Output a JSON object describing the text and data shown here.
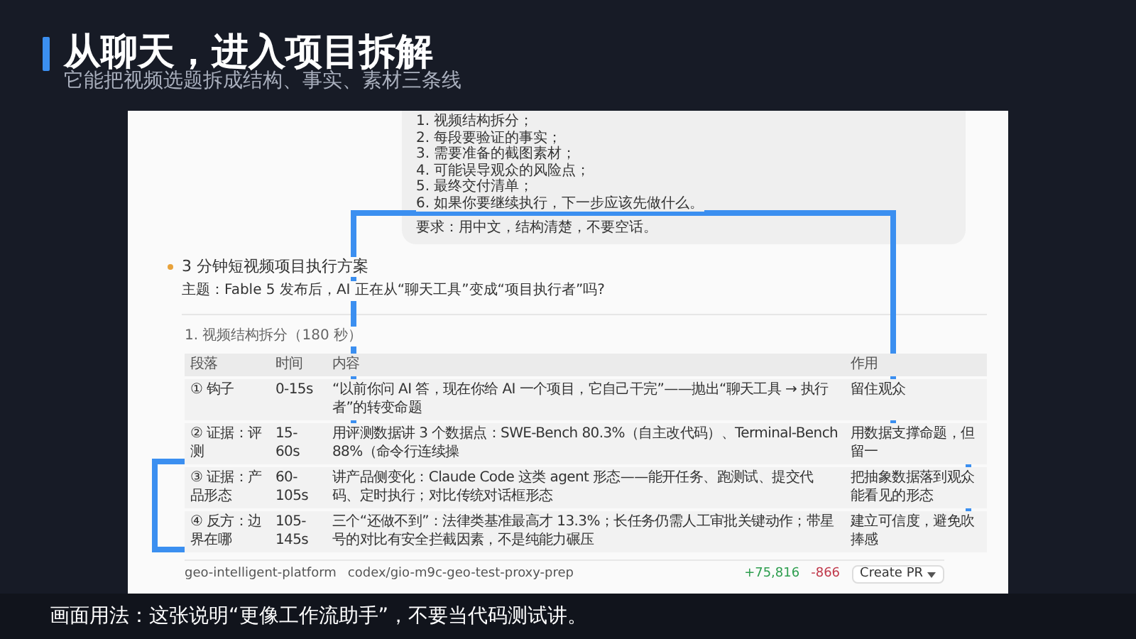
{
  "slide": {
    "title": "从聊天，进入项目拆解",
    "subtitle": "它能把视频选题拆成结构、事实、素材三条线"
  },
  "chat": {
    "items": [
      "1. 视频结构拆分；",
      "2. 每段要验证的事实；",
      "3. 需要准备的截图素材；",
      "4. 可能误导观众的风险点；",
      "5. 最终交付清单；",
      "6. 如果你要继续执行，下一步应该先做什么。"
    ],
    "requirement": "要求：用中文，结构清楚，不要空话。"
  },
  "plan": {
    "heading": "3 分钟短视频项目执行方案",
    "topic": "主题：Fable 5 发布后，AI 正在从“聊天工具”变成“项目执行者”吗?",
    "section": "1. 视频结构拆分（180 秒）",
    "table": {
      "columns": [
        "段落",
        "时间",
        "内容",
        "作用"
      ],
      "rows": [
        [
          "① 钩子",
          "0-15s",
          "“以前你问 AI 答，现在你给 AI 一个项目，它自己干完”——抛出“聊天工具 → 执行者”的转变命题",
          "留住观众"
        ],
        [
          "② 证据：评测",
          "15-60s",
          "用评测数据讲 3 个数据点：SWE-Bench 80.3%（自主改代码）、Terminal-Bench 88%（命令行连续操",
          "用数据支撑命题，但留一"
        ],
        [
          "③ 证据：产品形态",
          "60-105s",
          "讲产品侧变化：Claude Code 这类 agent 形态——能开任务、跑测试、提交代码、定时执行；对比传统对话框形态",
          "把抽象数据落到观众能看见的形态"
        ],
        [
          "④ 反方：边界在哪",
          "105-145s",
          "三个“还做不到”：法律类基准最高才 13.3%；长任务仍需人工审批关键动作；带星号的对比有安全拦截因素，不是纯能力碾压",
          "建立可信度，避免吹捧感"
        ]
      ]
    }
  },
  "footer_bar": {
    "repo": "geo-intelligent-platform",
    "branch": "codex/gio-m9c-geo-test-proxy-prep",
    "additions": "+75,816",
    "deletions": "-866",
    "button": "Create PR"
  },
  "caption": "画面用法：这张说明“更像工作流助手”，不要当代码测试讲。"
}
